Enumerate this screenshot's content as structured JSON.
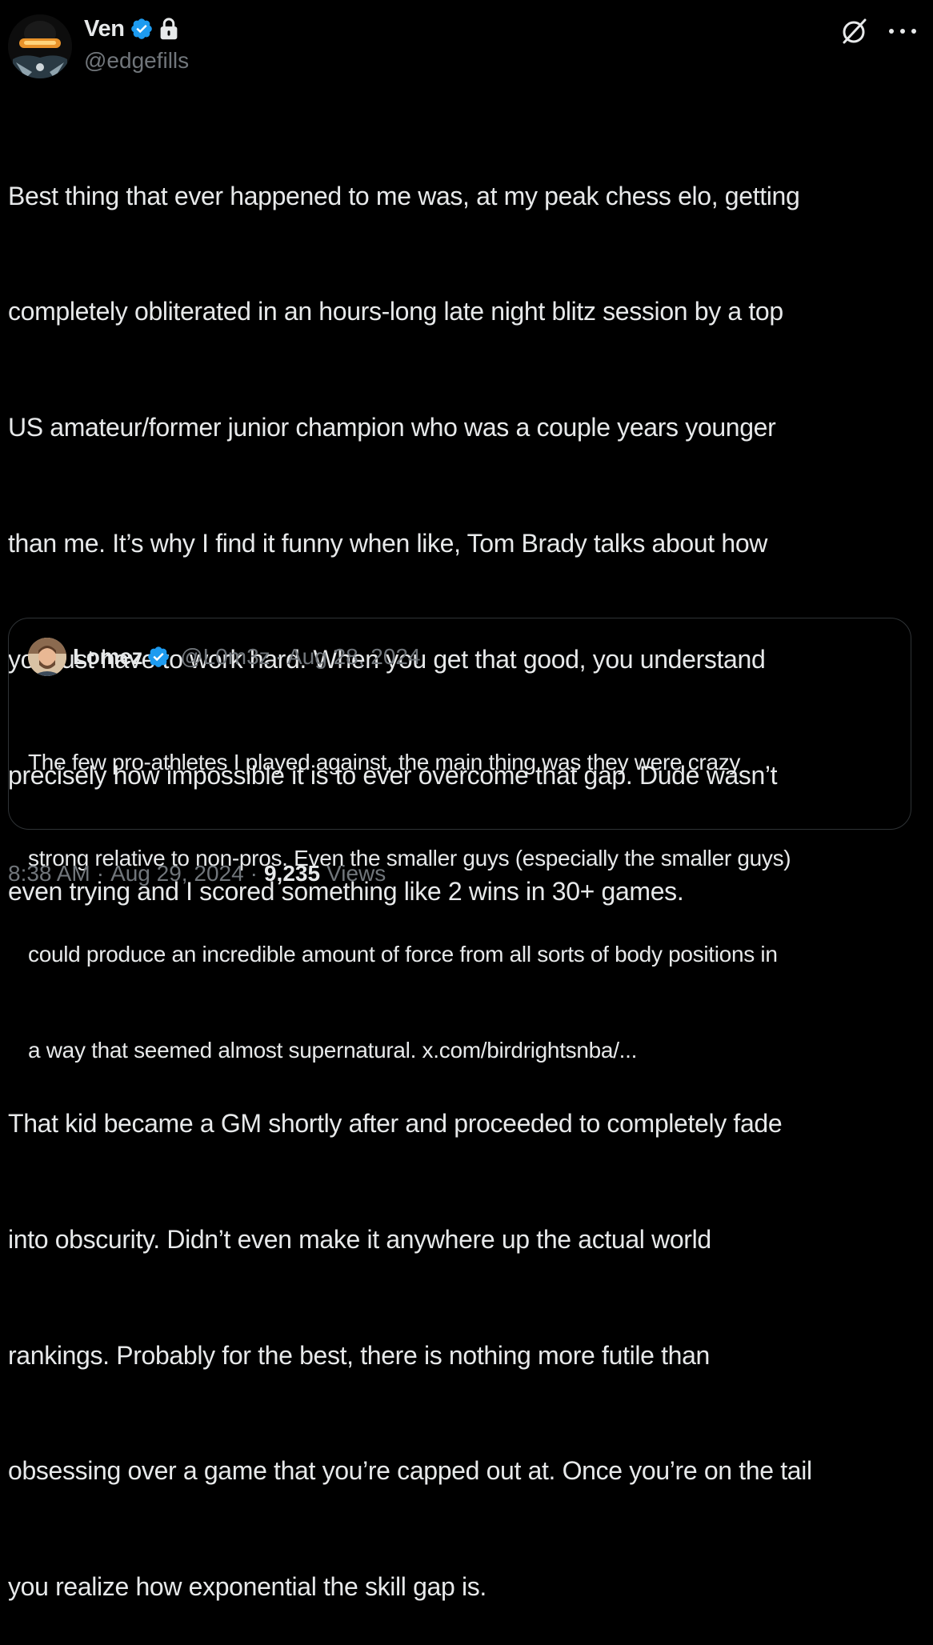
{
  "author": {
    "display_name": "Ven",
    "handle": "@edgefills",
    "avatar_icon": "avatar-dark-visor-icon",
    "badges": [
      "verified-badge-icon",
      "lock-icon"
    ]
  },
  "header_actions": {
    "grok_icon": "grok-icon",
    "more_icon": "more-icon"
  },
  "tweet": {
    "lines": [
      "Best thing that ever happened to me was, at my peak chess elo, getting",
      "completely obliterated in an hours-long late night blitz session by a top",
      "US amateur/former junior champion who was a couple years younger",
      "than me. It’s why I find it funny when like, Tom Brady talks about how",
      "you just have to work hard. When you get that good, you understand",
      "precisely how impossible it is to ever overcome that gap. Dude wasn’t",
      "even trying and I scored something like 2 wins in 30+ games.",
      "",
      "That kid became a GM shortly after and proceeded to completely fade",
      "into obscurity. Didn’t even make it anywhere up the actual world",
      "rankings. Probably for the best, there is nothing more futile than",
      "obsessing over a game that you’re capped out at. Once you’re on the tail",
      "you realize how exponential the skill gap is."
    ]
  },
  "quote": {
    "display_name": "Lomez",
    "handle": "@L0m3z",
    "separator": "·",
    "date": "Aug 28, 2024",
    "lines": [
      "The few pro-athletes I played against, the main thing was they were crazy",
      "strong relative to non-pros. Even the smaller guys (especially the smaller guys)",
      "could produce an incredible amount of force from all sorts of body positions in",
      "a way that seemed almost supernatural. x.com/birdrightsnba/..."
    ]
  },
  "meta": {
    "time": "8:38 AM",
    "dot1": "·",
    "date": "Aug 29, 2024",
    "dot2": "·",
    "views_count": "9,235",
    "views_label": "Views"
  },
  "colors": {
    "background": "#000000",
    "text_primary": "#e7e9ea",
    "text_secondary": "#71767b",
    "verified_blue": "#1d9bf0",
    "border": "#2f3336"
  }
}
